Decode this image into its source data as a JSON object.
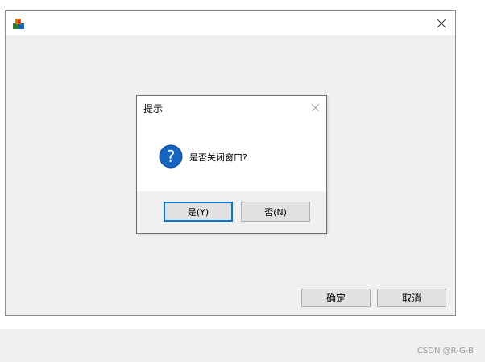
{
  "main_window": {
    "title": "",
    "ok_label": "确定",
    "cancel_label": "取消"
  },
  "message_box": {
    "title": "提示",
    "message": "是否关闭窗口?",
    "yes_label": "是(Y)",
    "no_label": "否(N)",
    "icon": "question-icon"
  },
  "footer": {
    "watermark": "CSDN @R-G-B"
  },
  "colors": {
    "focus_border": "#0078d7",
    "question_icon": "#1565c0",
    "button_face": "#e1e1e1",
    "window_bg": "#f0f0f0"
  }
}
